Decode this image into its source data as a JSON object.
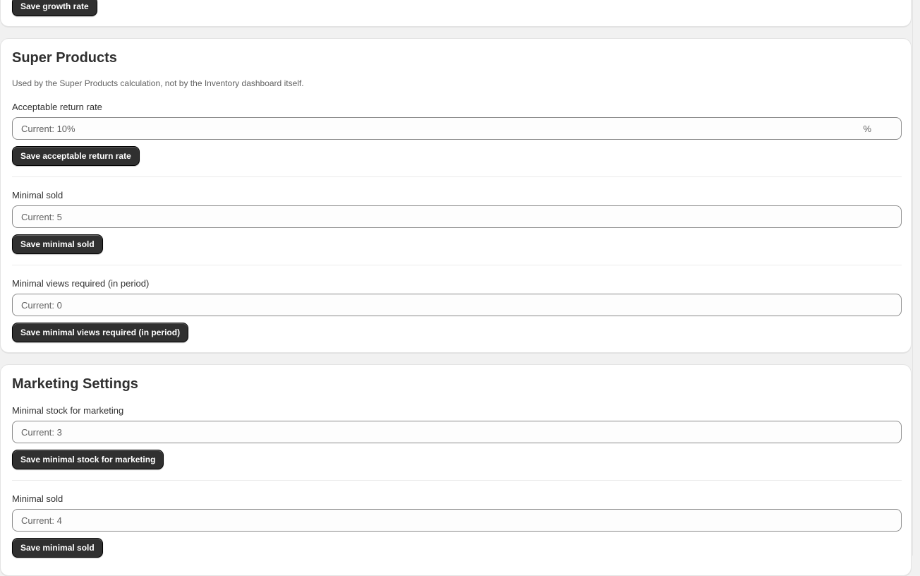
{
  "top_section": {
    "save_growth_rate_label": "Save growth rate"
  },
  "super_products": {
    "title": "Super Products",
    "description": "Used by the Super Products calculation, not by the Inventory dashboard itself.",
    "fields": [
      {
        "label": "Acceptable return rate",
        "placeholder": "Current: 10%",
        "suffix": "%",
        "button": "Save acceptable return rate"
      },
      {
        "label": "Minimal sold",
        "placeholder": "Current: 5",
        "button": "Save minimal sold"
      },
      {
        "label": "Minimal views required (in period)",
        "placeholder": "Current: 0",
        "button": "Save minimal views required (in period)"
      }
    ]
  },
  "marketing_settings": {
    "title": "Marketing Settings",
    "fields": [
      {
        "label": "Minimal stock for marketing",
        "placeholder": "Current: 3",
        "button": "Save minimal stock for marketing"
      },
      {
        "label": "Minimal sold",
        "placeholder": "Current: 4",
        "button": "Save minimal sold"
      }
    ]
  }
}
